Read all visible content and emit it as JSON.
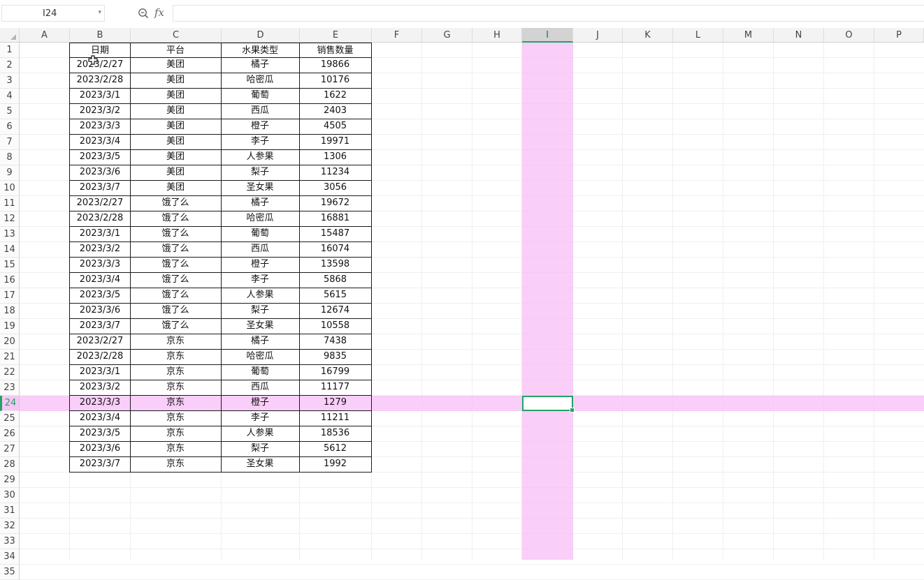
{
  "formula_bar": {
    "name_box": "I24",
    "fx_label": "fx",
    "formula": ""
  },
  "columns": [
    "A",
    "B",
    "C",
    "D",
    "E",
    "F",
    "G",
    "H",
    "I",
    "J",
    "K",
    "L",
    "M",
    "N",
    "O",
    "P"
  ],
  "active_column": "I",
  "active_row": "24",
  "row_numbers": [
    "1",
    "2",
    "3",
    "4",
    "5",
    "6",
    "7",
    "8",
    "9",
    "10",
    "11",
    "12",
    "13",
    "14",
    "15",
    "16",
    "17",
    "18",
    "19",
    "20",
    "21",
    "22",
    "23",
    "24",
    "25",
    "26",
    "27",
    "28",
    "29",
    "30",
    "31",
    "32",
    "33",
    "34",
    "35"
  ],
  "table": {
    "headers": [
      "日期",
      "平台",
      "水果类型",
      "销售数量"
    ],
    "rows": [
      [
        "2023/2/27",
        "美团",
        "橘子",
        "19866"
      ],
      [
        "2023/2/28",
        "美团",
        "哈密瓜",
        "10176"
      ],
      [
        "2023/3/1",
        "美团",
        "葡萄",
        "1622"
      ],
      [
        "2023/3/2",
        "美团",
        "西瓜",
        "2403"
      ],
      [
        "2023/3/3",
        "美团",
        "橙子",
        "4505"
      ],
      [
        "2023/3/4",
        "美团",
        "李子",
        "19971"
      ],
      [
        "2023/3/5",
        "美团",
        "人参果",
        "1306"
      ],
      [
        "2023/3/6",
        "美团",
        "梨子",
        "11234"
      ],
      [
        "2023/3/7",
        "美团",
        "圣女果",
        "3056"
      ],
      [
        "2023/2/27",
        "饿了么",
        "橘子",
        "19672"
      ],
      [
        "2023/2/28",
        "饿了么",
        "哈密瓜",
        "16881"
      ],
      [
        "2023/3/1",
        "饿了么",
        "葡萄",
        "15487"
      ],
      [
        "2023/3/2",
        "饿了么",
        "西瓜",
        "16074"
      ],
      [
        "2023/3/3",
        "饿了么",
        "橙子",
        "13598"
      ],
      [
        "2023/3/4",
        "饿了么",
        "李子",
        "5868"
      ],
      [
        "2023/3/5",
        "饿了么",
        "人参果",
        "5615"
      ],
      [
        "2023/3/6",
        "饿了么",
        "梨子",
        "12674"
      ],
      [
        "2023/3/7",
        "饿了么",
        "圣女果",
        "10558"
      ],
      [
        "2023/2/27",
        "京东",
        "橘子",
        "7438"
      ],
      [
        "2023/2/28",
        "京东",
        "哈密瓜",
        "9835"
      ],
      [
        "2023/3/1",
        "京东",
        "葡萄",
        "16799"
      ],
      [
        "2023/3/2",
        "京东",
        "西瓜",
        "11177"
      ],
      [
        "2023/3/3",
        "京东",
        "橙子",
        "1279"
      ],
      [
        "2023/3/4",
        "京东",
        "李子",
        "11211"
      ],
      [
        "2023/3/5",
        "京东",
        "人参果",
        "18536"
      ],
      [
        "2023/3/6",
        "京东",
        "梨子",
        "5612"
      ],
      [
        "2023/3/7",
        "京东",
        "圣女果",
        "1992"
      ]
    ]
  },
  "colors": {
    "accent": "#21a366",
    "crosshair": "#f7bef6"
  },
  "icons": {
    "zoom": "zoom-icon",
    "cursor": "cell-cursor-icon"
  }
}
